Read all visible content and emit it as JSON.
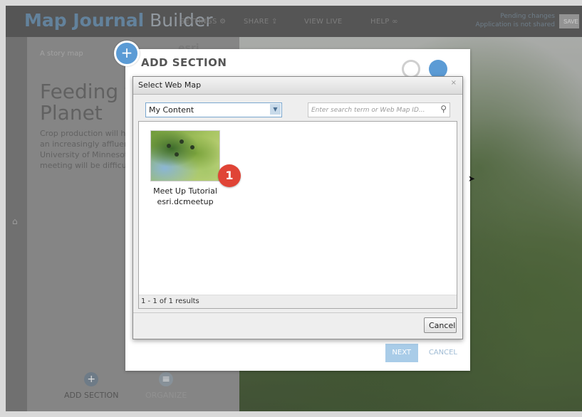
{
  "topbar": {
    "brand_bold": "Map Journal",
    "brand_light": "Builder",
    "settings": "SETTINGS",
    "share": "SHARE",
    "view_live": "VIEW LIVE",
    "help": "HELP",
    "pending_line1": "Pending changes",
    "pending_line2": "Application is not shared",
    "save": "SAVE"
  },
  "sidebar": {
    "story_label": "A story map",
    "esri_logo": "esri",
    "title": "Feeding the Planet",
    "body": "Crop production will have to fulfill the needs of an increasingly affluent population, the University of Minnesota's Environment meeting will be difficult but not impossible.",
    "add_section": "ADD SECTION",
    "organize": "ORGANIZE"
  },
  "add_section_panel": {
    "title": "ADD SECTION",
    "next": "NEXT",
    "cancel": "CANCEL"
  },
  "dialog": {
    "title": "Select Web Map",
    "close_glyph": "×",
    "source_selected": "My Content",
    "search_placeholder": "Enter search term or Web Map ID...",
    "results": [
      {
        "title": "Meet Up Tutorial",
        "owner": "esri.dcmeetup"
      }
    ],
    "badge": "1",
    "status": "1 - 1 of 1 results",
    "cancel": "Cancel"
  },
  "colors": {
    "accent": "#5b9bd5",
    "badge": "#e04436"
  }
}
